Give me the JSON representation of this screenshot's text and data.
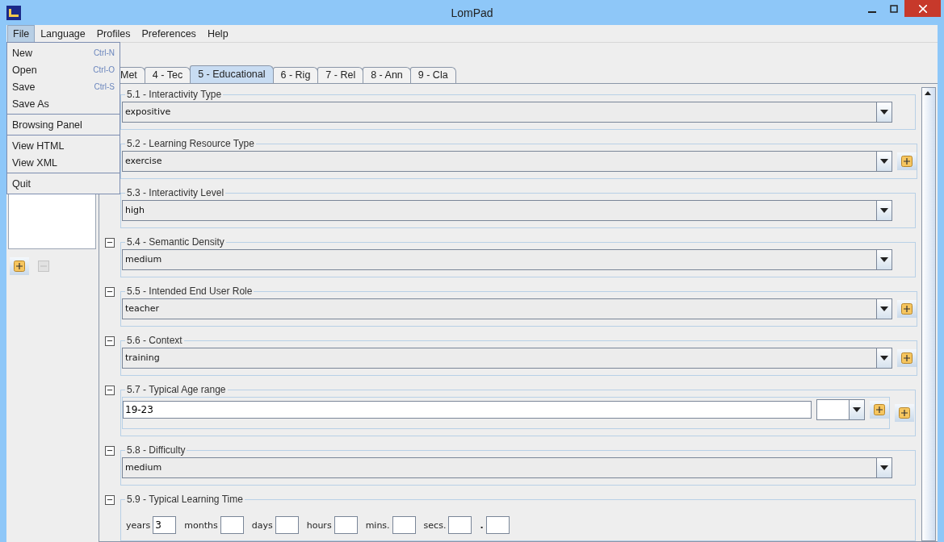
{
  "window": {
    "title": "LomPad"
  },
  "menubar": [
    {
      "label": "File",
      "selected": true
    },
    {
      "label": "Language",
      "selected": false
    },
    {
      "label": "Profiles",
      "selected": false
    },
    {
      "label": "Preferences",
      "selected": false
    },
    {
      "label": "Help",
      "selected": false
    }
  ],
  "file_menu": {
    "groups": [
      [
        {
          "label": "New",
          "shortcut": "Ctrl-N"
        },
        {
          "label": "Open",
          "shortcut": "Ctrl-O"
        },
        {
          "label": "Save",
          "shortcut": "Ctrl-S"
        },
        {
          "label": "Save As"
        }
      ],
      [
        {
          "label": "Browsing Panel"
        }
      ],
      [
        {
          "label": "View HTML"
        },
        {
          "label": "View XML"
        }
      ],
      [
        {
          "label": "Quit"
        }
      ]
    ]
  },
  "left_panel": {
    "buttons": [
      {
        "kind": "add",
        "disabled": false
      },
      {
        "kind": "remove",
        "disabled": true
      }
    ]
  },
  "tabs": [
    {
      "label": "Met",
      "selected": false
    },
    {
      "label": "4 - Tec",
      "selected": false
    },
    {
      "label": "5 - Educational",
      "selected": true
    },
    {
      "label": "6 - Rig",
      "selected": false
    },
    {
      "label": "7 - Rel",
      "selected": false
    },
    {
      "label": "8 - Ann",
      "selected": false
    },
    {
      "label": "9 - Cla",
      "selected": false
    }
  ],
  "sections": [
    {
      "kind": "select",
      "title": "5.1 - Interactivity Type",
      "value": "expositive",
      "add": false
    },
    {
      "kind": "select",
      "title": "5.2 - Learning Resource Type",
      "value": "exercise",
      "add": true
    },
    {
      "kind": "select",
      "title": "5.3 - Interactivity Level",
      "value": "high",
      "add": false
    },
    {
      "kind": "select",
      "toggle": "−",
      "title": "5.4 - Semantic Density",
      "value": "medium",
      "add": false
    },
    {
      "kind": "select",
      "toggle": "−",
      "title": "5.5 - Intended End User Role",
      "value": "teacher",
      "add": true
    },
    {
      "kind": "select",
      "toggle": "−",
      "title": "5.6 - Context",
      "value": "training",
      "add": true
    },
    {
      "kind": "age",
      "toggle": "−",
      "title": "5.7 - Typical Age range",
      "value": "19-23",
      "add": true
    },
    {
      "kind": "select",
      "toggle": "−",
      "title": "5.8 - Difficulty",
      "value": "medium",
      "add": false
    },
    {
      "kind": "duration",
      "toggle": "−",
      "title": "5.9 - Typical Learning Time",
      "parts": [
        {
          "label": "years",
          "value": "3"
        },
        {
          "label": "months"
        },
        {
          "label": "days"
        },
        {
          "label": "hours"
        },
        {
          "label": "mins."
        },
        {
          "label": "secs."
        },
        {
          "label": "."
        }
      ]
    }
  ]
}
